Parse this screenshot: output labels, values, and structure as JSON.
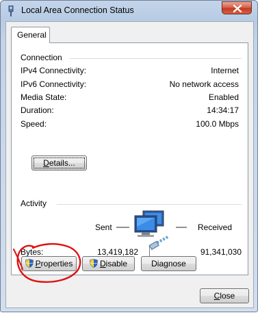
{
  "window": {
    "title": "Local Area Connection Status"
  },
  "tabs": [
    {
      "label": "General"
    }
  ],
  "connection": {
    "group_label": "Connection",
    "rows": [
      {
        "label": "IPv4 Connectivity:",
        "value": "Internet"
      },
      {
        "label": "IPv6 Connectivity:",
        "value": "No network access"
      },
      {
        "label": "Media State:",
        "value": "Enabled"
      },
      {
        "label": "Duration:",
        "value": "14:34:17"
      },
      {
        "label": "Speed:",
        "value": "100.0 Mbps"
      }
    ],
    "details_button": {
      "label_u": "D",
      "label_rest": "etails..."
    }
  },
  "activity": {
    "group_label": "Activity",
    "sent_label": "Sent",
    "received_label": "Received",
    "bytes_label": "Bytes:",
    "bytes_sent": "13,419,182",
    "bytes_received": "91,341,030"
  },
  "buttons": {
    "properties": {
      "label_u": "P",
      "label_rest": "roperties"
    },
    "disable": {
      "label_u": "D",
      "label_rest": "isable"
    },
    "diagnose": {
      "label_pre": "Diagnose"
    },
    "close": {
      "label_u": "C",
      "label_rest": "lose"
    }
  },
  "colors": {
    "annotation_red": "#e01010",
    "titlebar": "#b7cbe4",
    "close_button": "#c43b24"
  }
}
